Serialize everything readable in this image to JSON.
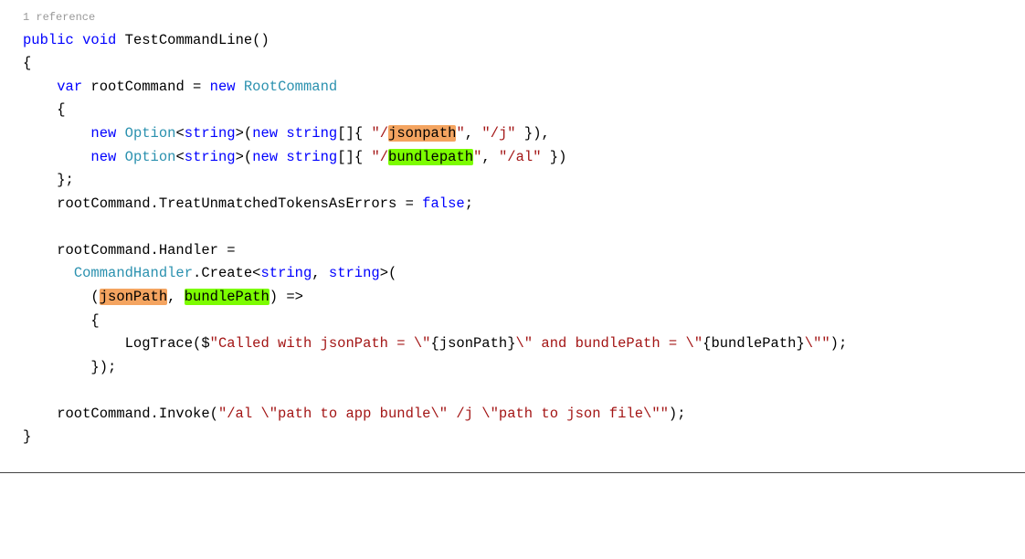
{
  "reference": "1 reference",
  "code": {
    "l1_public": "public",
    "l1_void": "void",
    "l1_method": " TestCommandLine()",
    "l2": "{",
    "l3_var": "var",
    "l3_a": " rootCommand = ",
    "l3_new": "new",
    "l3_sp": " ",
    "l3_type": "RootCommand",
    "l4": "    {",
    "l5_new": "new",
    "l5_sp": " ",
    "l5_type": "Option",
    "l5_b": "<",
    "l5_string": "string",
    "l5_c": ">(",
    "l5_new2": "new",
    "l5_d": " ",
    "l5_string2": "string",
    "l5_e": "[]{ ",
    "l5_str1": "\"/",
    "l5_hl1": "jsonpath",
    "l5_str1b": "\"",
    "l5_f": ", ",
    "l5_str2": "\"/j\"",
    "l5_g": " }),",
    "l6_new": "new",
    "l6_sp": " ",
    "l6_type": "Option",
    "l6_b": "<",
    "l6_string": "string",
    "l6_c": ">(",
    "l6_new2": "new",
    "l6_d": " ",
    "l6_string2": "string",
    "l6_e": "[]{ ",
    "l6_str1": "\"/",
    "l6_hl1": "bundlepath",
    "l6_str1b": "\"",
    "l6_f": ", ",
    "l6_str2": "\"/al\"",
    "l6_g": " })",
    "l7": "    };",
    "l8_a": "    rootCommand.TreatUnmatchedTokensAsErrors = ",
    "l8_false": "false",
    "l8_b": ";",
    "l9": "",
    "l10": "    rootCommand.Handler =",
    "l11_a": "      ",
    "l11_type": "CommandHandler",
    "l11_b": ".Create<",
    "l11_string": "string",
    "l11_c": ", ",
    "l11_string2": "string",
    "l11_d": ">(",
    "l12_a": "        (",
    "l12_hl1": "jsonPath",
    "l12_b": ", ",
    "l12_hl2": "bundlePath",
    "l12_c": ") =>",
    "l13": "        {",
    "l14_a": "            LogTrace($",
    "l14_str1": "\"Called with jsonPath = \\\"",
    "l14_b": "{jsonPath}",
    "l14_str2": "\\\" and bundlePath = \\\"",
    "l14_c": "{bundlePath}",
    "l14_str3": "\\\"\"",
    "l14_d": ");",
    "l15": "        });",
    "l16": "",
    "l17_a": "    rootCommand.Invoke(",
    "l17_str": "\"/al \\\"path to app bundle\\\" /j \\\"path to json file\\\"\"",
    "l17_b": ");",
    "l18": "}"
  }
}
